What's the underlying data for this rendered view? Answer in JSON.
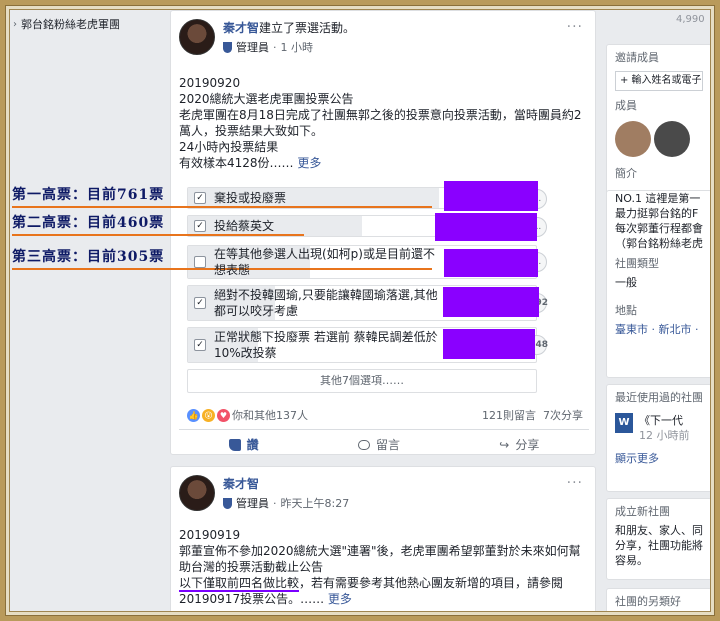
{
  "left_sidebar": {
    "group_link": "郭台銘粉絲老虎軍團"
  },
  "post1": {
    "author": "秦才智",
    "action_text": "建立了票選活動。",
    "role": "管理員",
    "time": "1 小時",
    "lines": [
      "20190920",
      "2020總統大選老虎軍團投票公告",
      "老虎軍團在8月18日完成了社團無郭之後的投票意向投票活動，當時團員約2萬人，投票結果大致如下。",
      "24小時內投票結果",
      "有效樣本4128份……"
    ],
    "more_label": "更多",
    "poll_options": [
      {
        "label": "棄投或投廢票",
        "checked": true,
        "ctrl": "...",
        "fill": 0.72
      },
      {
        "label": "投給蔡英文",
        "checked": true,
        "ctrl": "...",
        "fill": 0.5
      },
      {
        "label": "在等其他參選人出現(如柯p)或是目前還不想表態",
        "checked": false,
        "ctrl": "...",
        "fill": 0.35
      },
      {
        "label": "絕對不投韓國瑜,只要能讓韓國瑜落選,其他都可以咬牙考慮",
        "checked": true,
        "ctrl": "+92",
        "fill": 0.25
      },
      {
        "label": "正常狀態下投廢票 若選前 蔡韓民調差低於10%改投蔡",
        "checked": true,
        "ctrl": "+48",
        "fill": 0.2
      }
    ],
    "other_options": "其他7個選項……",
    "reactions_text": "你和其他137人",
    "comments_count": "121則留言",
    "shares_count": "7次分享",
    "actions": {
      "like": "讚",
      "comment": "留言",
      "share": "分享"
    }
  },
  "post2": {
    "author": "秦才智",
    "role": "管理員",
    "time": "昨天上午8:27",
    "lines": [
      "20190919",
      "郭董宣佈不參加2020總統大選\"連署\"後，老虎軍團希望郭董對於未來如何幫助台灣的投票活動截止公告"
    ],
    "underlined_text": "以下僅取前四名做比較",
    "rest_text": "，若有需要參考其他熱心團友新增的項目，請參閱20190917投票公告。……",
    "more_label": "更多"
  },
  "annotations": [
    {
      "text": "第一高票：目前761票"
    },
    {
      "text": "第二高票：目前460票"
    },
    {
      "text": "第三高票：目前305票"
    }
  ],
  "right_sidebar": {
    "top_count": "4,990",
    "invite_head": "邀請成員",
    "invite_input": "+ 輸入姓名或電子",
    "members_head": "成員",
    "intro_head": "簡介",
    "intro_lines": [
      "NO.1 這裡是第一",
      "最力挺郭台銘的F",
      "每次郭董行程都會",
      "",
      "（郭台銘粉絲老虎"
    ],
    "group_type_head": "社團類型",
    "group_type": "一般",
    "location_head": "地點",
    "location": "臺東市 · 新北市 ·",
    "recent_head": "最近使用過的社團",
    "recent_item_title": "《下一代",
    "recent_item_time": "12 小時前",
    "see_more": "顯示更多",
    "new_group_head": "成立新社團",
    "new_group_lines": [
      "和朋友、家人、同",
      "分享，社團功能將",
      "容易。"
    ],
    "bottom_head": "社團的另類好"
  },
  "colors": {
    "annotation_line": "#e8741c",
    "redaction": "#8a00ff",
    "link": "#385898"
  }
}
